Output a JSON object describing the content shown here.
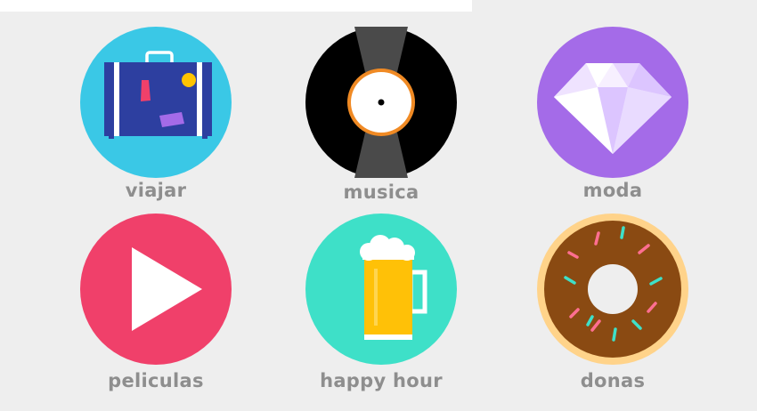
{
  "categories": [
    {
      "id": "viajar",
      "label": "viajar",
      "color": "#3ac8e6"
    },
    {
      "id": "musica",
      "label": "musica",
      "color": "#000000"
    },
    {
      "id": "moda",
      "label": "moda",
      "color": "#a46be8"
    },
    {
      "id": "peliculas",
      "label": "peliculas",
      "color": "#f0406a"
    },
    {
      "id": "happy-hour",
      "label": "happy hour",
      "color": "#3ee0c8"
    },
    {
      "id": "donas",
      "label": "donas",
      "color": "#ffd38a"
    }
  ]
}
